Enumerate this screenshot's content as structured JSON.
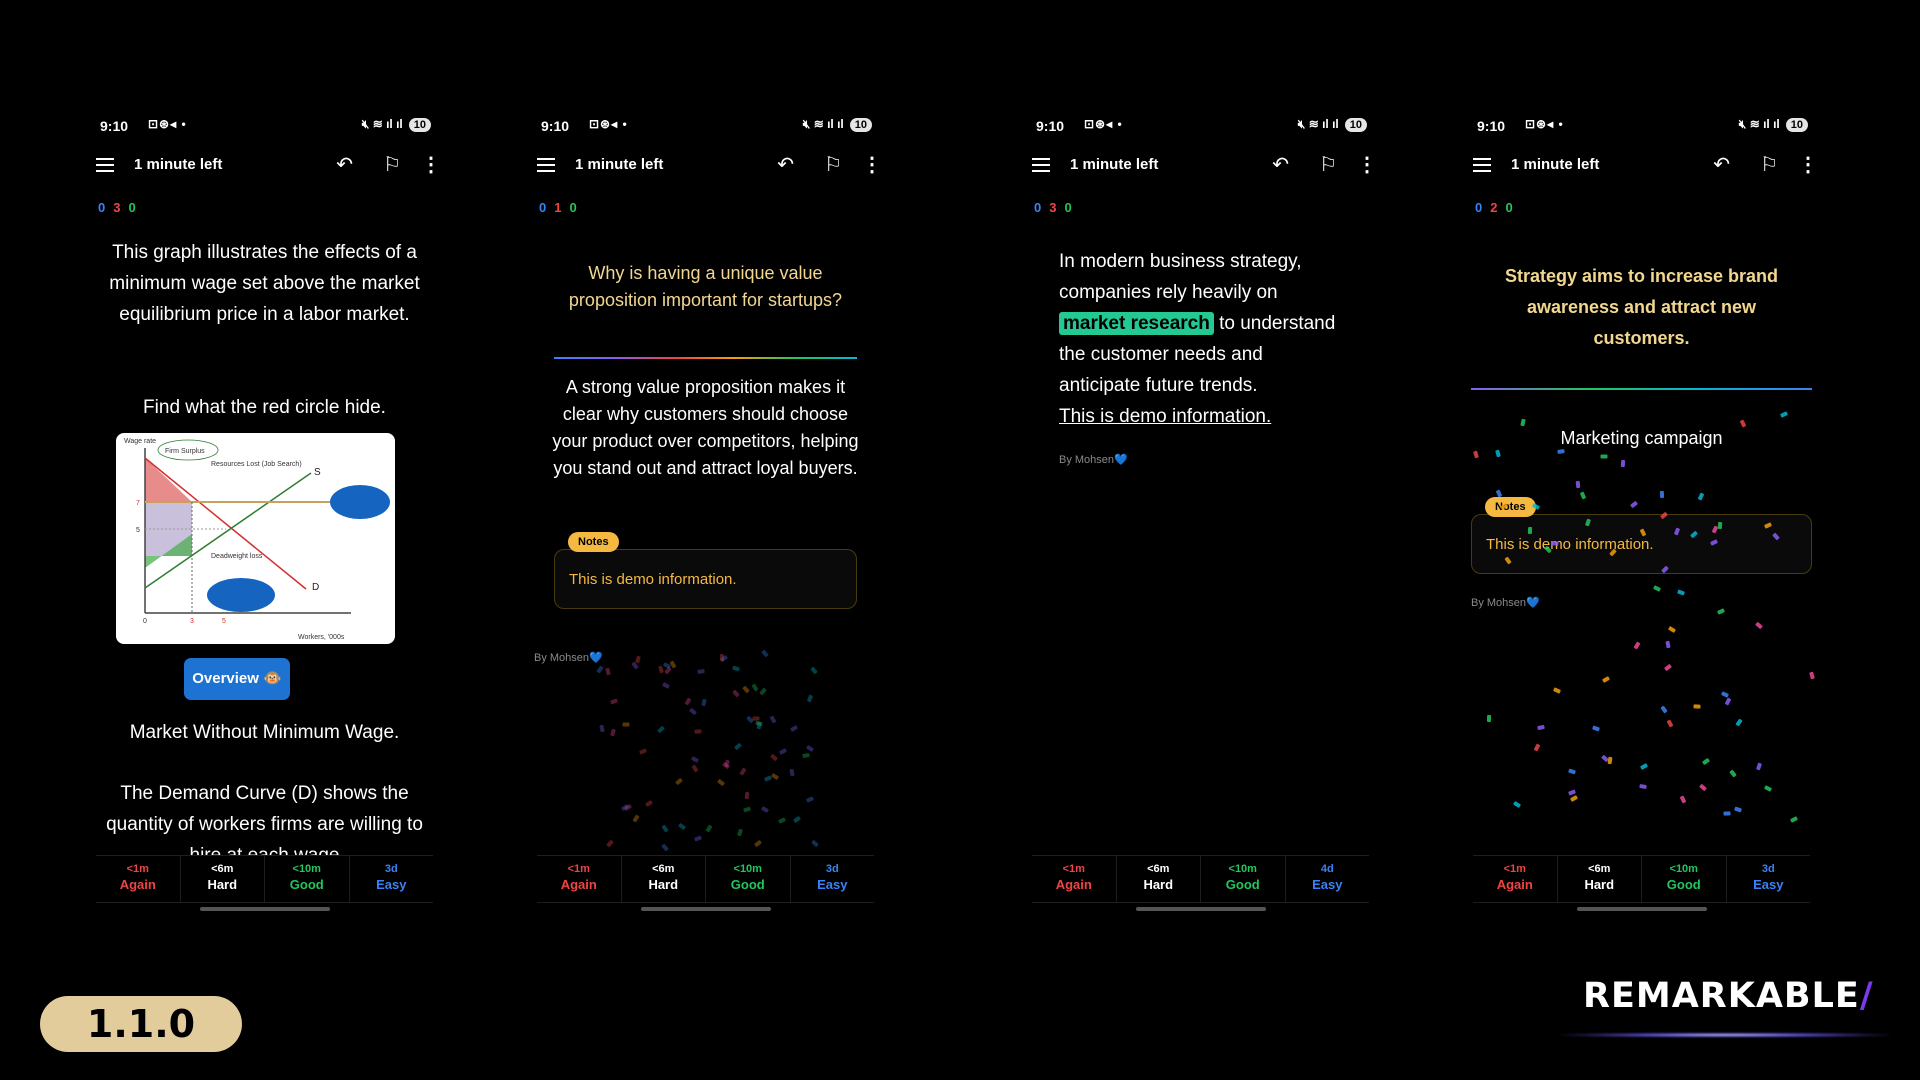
{
  "statusbar": {
    "time": "9:10",
    "battery": "10"
  },
  "appbar": {
    "title": "1 minute left"
  },
  "answer_labels": {
    "again": "Again",
    "hard": "Hard",
    "good": "Good",
    "easy": "Easy",
    "again_ivl": "<1m",
    "hard_ivl": "<6m",
    "good_ivl": "<10m"
  },
  "phone1": {
    "counts": {
      "new": "0",
      "learn": "3",
      "review": "0"
    },
    "text1": "This graph illustrates the effects of a minimum wage set above the market equilibrium price in a labor market.",
    "text2": "Find what the red circle hide.",
    "graph": {
      "ylabel": "Wage rate",
      "firm_surplus": "Firm Surplus",
      "resources_lost": "Resources Lost (Job Search)",
      "deadweight": "Deadweight loss",
      "s": "S",
      "d": "D",
      "y7": "7",
      "y5": "5",
      "x0": "0",
      "x3": "3",
      "x5": "5",
      "xlabel": "Workers, '000s"
    },
    "overview": "Overview 🐵",
    "text3": "Market Without Minimum Wage.",
    "text4": "The Demand Curve (D) shows the quantity of workers firms are willing to hire at each wage",
    "easy_ivl": "3d"
  },
  "phone2": {
    "counts": {
      "new": "0",
      "learn": "1",
      "review": "0"
    },
    "question": "Why is having a unique value proposition important for startups?",
    "answer": "A strong value proposition makes it clear why customers should choose your product over competitors, helping you stand out and attract loyal buyers.",
    "notes_tag": "Notes",
    "notes_text": "This is demo information.",
    "byline": "By Mohsen💙",
    "easy_ivl": "3d"
  },
  "phone3": {
    "counts": {
      "new": "0",
      "learn": "3",
      "review": "0"
    },
    "line1": "In modern business strategy,",
    "line2": "companies rely heavily on",
    "highlight": "market research",
    "line3_rest": " to understand",
    "line4": "the customer needs and",
    "line5": "anticipate future trends.",
    "underline": "This is demo information.",
    "byline": "By Mohsen💙",
    "easy_ivl": "4d"
  },
  "phone4": {
    "counts": {
      "new": "0",
      "learn": "2",
      "review": "0"
    },
    "front": "Strategy aims to increase brand awareness and attract new customers.",
    "back": "Marketing campaign",
    "notes_tag": "Notes",
    "notes_text": "This is demo information.",
    "byline": "By Mohsen💙",
    "easy_ivl": "3d"
  },
  "footer": {
    "version": "1.1.0",
    "brand": "REMARKABLE",
    "brand_slash": "/"
  }
}
